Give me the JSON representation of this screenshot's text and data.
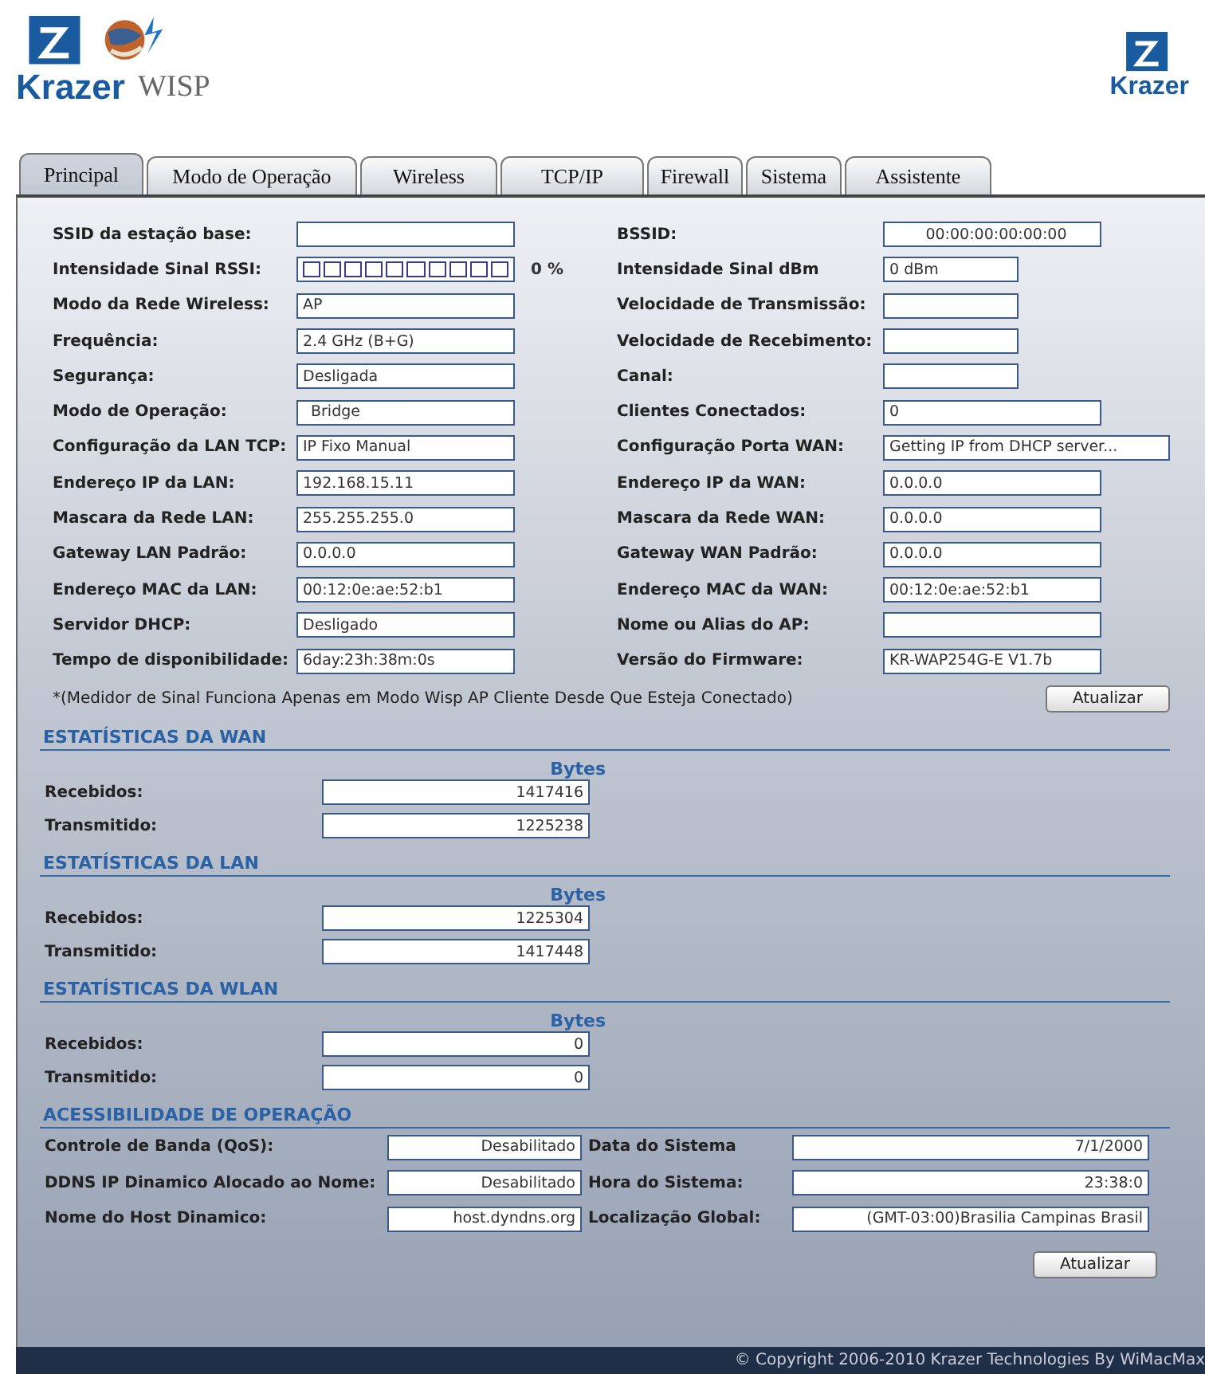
{
  "header": {
    "brand": "Krazer",
    "product": "WISP",
    "brand_right": "Krazer"
  },
  "tabs": [
    {
      "label": "Principal",
      "selected": true
    },
    {
      "label": "Modo de Operação",
      "selected": false
    },
    {
      "label": "Wireless",
      "selected": false
    },
    {
      "label": "TCP/IP",
      "selected": false
    },
    {
      "label": "Firewall",
      "selected": false
    },
    {
      "label": "Sistema",
      "selected": false
    },
    {
      "label": "Assistente",
      "selected": false
    }
  ],
  "status": {
    "rows": [
      {
        "left": {
          "label": "SSID da estação base:",
          "kind": "field"
        },
        "right": {
          "label": "BSSID:",
          "value": "00:00:00:00:00:00",
          "kind": "centered"
        }
      },
      {
        "left": {
          "label": "Intensidade Sinal RSSI:",
          "kind": "meter",
          "level": 0,
          "reading": "0 %"
        },
        "right": {
          "label": "Intensidade Sinal dBm",
          "value": "0 dBm",
          "kind": "short"
        }
      },
      {
        "left": {
          "label": "Modo da Rede Wireless:",
          "value": "AP",
          "kind": "field"
        },
        "right": {
          "label": "Velocidade de Transmissão:",
          "kind": "short"
        }
      },
      {
        "left": {
          "label": "Frequência:",
          "value": "2.4 GHz (B+G)",
          "kind": "field"
        },
        "right": {
          "label": "Velocidade de Recebimento:",
          "kind": "short"
        }
      },
      {
        "left": {
          "label": "Segurança:",
          "value": "Desligada",
          "kind": "field"
        },
        "right": {
          "label": "Canal:",
          "kind": "short"
        }
      },
      {
        "left": {
          "label": "Modo de Operação:",
          "value": "Bridge",
          "kind": "centered"
        },
        "right": {
          "label": "Clientes Conectados:",
          "value": "0",
          "kind": "field"
        }
      },
      {
        "left": {
          "label": "Configuração da LAN TCP:",
          "value": "IP Fixo Manual",
          "kind": "field"
        },
        "right": {
          "label": "Configuração Porta WAN:",
          "value": "Getting IP from DHCP server...",
          "kind": "long"
        }
      },
      {
        "left": {
          "label": "Endereço IP da LAN:",
          "value": "192.168.15.11",
          "kind": "field"
        },
        "right": {
          "label": "Endereço IP da WAN:",
          "value": "0.0.0.0",
          "kind": "field"
        }
      },
      {
        "left": {
          "label": "Mascara da Rede LAN:",
          "value": "255.255.255.0",
          "kind": "field"
        },
        "right": {
          "label": "Mascara da Rede WAN:",
          "value": "0.0.0.0",
          "kind": "field"
        }
      },
      {
        "left": {
          "label": "Gateway LAN Padrão:",
          "value": "0.0.0.0",
          "kind": "field"
        },
        "right": {
          "label": "Gateway WAN Padrão:",
          "value": "0.0.0.0",
          "kind": "field"
        }
      },
      {
        "left": {
          "label": "Endereço MAC da LAN:",
          "value": "00:12:0e:ae:52:b1",
          "kind": "field"
        },
        "right": {
          "label": "Endereço MAC da WAN:",
          "value": "00:12:0e:ae:52:b1",
          "kind": "field"
        }
      },
      {
        "left": {
          "label": "Servidor DHCP:",
          "value": "Desligado",
          "kind": "field"
        },
        "right": {
          "label": "Nome ou Alias do AP:",
          "kind": "field"
        }
      },
      {
        "left": {
          "label": "Tempo de disponibilidade:",
          "value": "6day:23h:38m:0s",
          "kind": "field"
        },
        "right": {
          "label": "Versão do Firmware:",
          "value": "KR-WAP254G-E V1.7b",
          "kind": "field"
        }
      }
    ],
    "note": "*(Medidor de Sinal Funciona Apenas em Modo Wisp AP Cliente Desde Que Esteja Conectado)",
    "button": "Atualizar"
  },
  "stats": [
    {
      "title": "ESTATÍSTICAS DA WAN",
      "column": "Bytes",
      "rows": [
        {
          "label": "Recebidos:",
          "value": "1417416"
        },
        {
          "label": "Transmitido:",
          "value": "1225238"
        }
      ]
    },
    {
      "title": "ESTATÍSTICAS DA LAN",
      "column": "Bytes",
      "rows": [
        {
          "label": "Recebidos:",
          "value": "1225304"
        },
        {
          "label": "Transmitido:",
          "value": "1417448"
        }
      ]
    },
    {
      "title": "ESTATÍSTICAS DA WLAN",
      "column": "Bytes",
      "rows": [
        {
          "label": "Recebidos:",
          "value": "0"
        },
        {
          "label": "Transmitido:",
          "value": "0"
        }
      ]
    }
  ],
  "access": {
    "title": "ACESSIBILIDADE DE OPERAÇÃO",
    "rows": [
      {
        "left": {
          "label": "Controle de Banda (QoS):",
          "value": "Desabilitado"
        },
        "right": {
          "label": "Data do Sistema",
          "value": "7/1/2000"
        }
      },
      {
        "left": {
          "label": "DDNS IP Dinamico Alocado ao Nome:",
          "value": "Desabilitado"
        },
        "right": {
          "label": "Hora do Sistema:",
          "value": "23:38:0"
        }
      },
      {
        "left": {
          "label": "Nome do Host Dinamico:",
          "value": "host.dyndns.org"
        },
        "right": {
          "label": "Localização Global:",
          "value": "(GMT-03:00)Brasilia Campinas Brasil"
        }
      }
    ],
    "button": "Atualizar"
  },
  "footer": "© Copyright 2006-2010 Krazer Technologies By WiMacMax"
}
